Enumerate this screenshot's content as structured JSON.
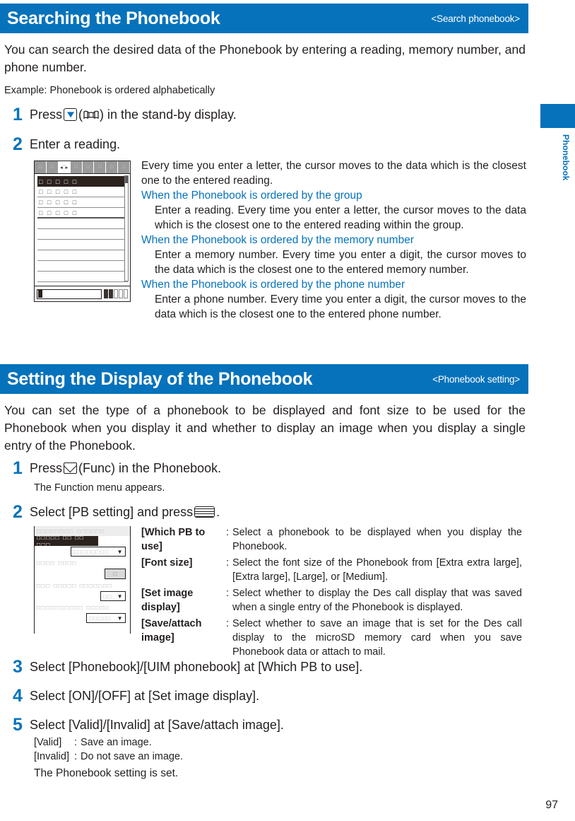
{
  "page": {
    "number": "97",
    "thumb_tab_label": "Phonebook",
    "accent_color": "#0672bb",
    "text_color": "#231f20"
  },
  "section1": {
    "title": "Searching the Phonebook",
    "tag": "<Search phonebook>",
    "intro": "You can search the desired data of the Phonebook by entering a reading, memory number, and phone number.",
    "example": "Example: Phonebook is ordered alphabetically",
    "steps": [
      {
        "num": "1",
        "before": "Press",
        "key": "down-key",
        "mid": "(",
        "key2": "phonebook-book-icon",
        "after": ") in the stand-by display."
      },
      {
        "num": "2",
        "text": "Enter a reading."
      }
    ],
    "descriptions": {
      "main": "Every time you enter a letter, the cursor moves to the data which is the closest one to the entered reading.",
      "blocks": [
        {
          "head": "When the Phonebook is ordered by the group",
          "body": "Enter a reading. Every time you enter a letter, the cursor moves to the data which is the closest one to the entered reading within the group."
        },
        {
          "head": "When the Phonebook is ordered by the memory number",
          "body": "Enter a memory number. Every time you enter a digit, the cursor moves to the data which is the closest one to the entered memory number."
        },
        {
          "head": "When the Phonebook is ordered by the phone number",
          "body": "Enter a phone number. Every time you enter a digit, the cursor moves to the data which is the closest one to the entered phone number."
        }
      ]
    }
  },
  "section2": {
    "title": "Setting the Display of the Phonebook",
    "tag": "<Phonebook setting>",
    "intro": "You can set the type of a phonebook to be displayed and font size to be used for the Phonebook when you display it and whether to display an image when you display a single entry of the Phonebook.",
    "steps": [
      {
        "num": "1",
        "before": "Press",
        "key": "mail-func-key",
        "after": "(Func) in the Phonebook.",
        "sub": "The Function menu appears."
      },
      {
        "num": "2",
        "before": "Select [PB setting] and press",
        "key": "select-key",
        "after": "."
      },
      {
        "num": "3",
        "text": "Select [Phonebook]/[UIM phonebook] at [Which PB to use]."
      },
      {
        "num": "4",
        "text": "Select [ON]/[OFF] at [Set image display]."
      },
      {
        "num": "5",
        "text": "Select [Valid]/[Invalid] at [Save/attach image]."
      }
    ],
    "settings": [
      {
        "term": "[Which PB to use]",
        "colon": ":",
        "desc": "Select a phonebook to be displayed when you display the Phonebook."
      },
      {
        "term": "[Font size]",
        "colon": ":",
        "desc": "Select the font size of the Phonebook from [Extra extra large], [Extra large], [Large], or [Medium]."
      },
      {
        "term": "[Set image display]",
        "colon": ":",
        "desc": "Select whether to display the Des call display that was saved when a single entry of the Phonebook is displayed."
      },
      {
        "term": "[Save/attach image]",
        "colon": ":",
        "desc": "Select whether to save an image that is set for the Des call display to the microSD memory card when you save Phonebook data or attach to mail."
      }
    ],
    "step5_values": [
      {
        "term": "[Valid]",
        "colon": ":",
        "desc": "Save an image."
      },
      {
        "term": "[Invalid]",
        "colon": ":",
        "desc": "Do not save an image."
      }
    ],
    "closing": "The Phonebook setting is set."
  },
  "mockup_search": {
    "tab_count": "9",
    "active_tab_index": "2",
    "rows": [
      "□ □ □ □ □",
      "□ □ □ □ □",
      "□ □ □ □ □",
      "□ □ □ □ □"
    ],
    "selected_row_index": "0"
  },
  "mockup_settings": {
    "title": "□□□□□□□□ □□□□□□",
    "highlight": "□□□□□ □□ □□ □□□",
    "field1_value": "□□□□□□□□",
    "label2": "□□□□ □□□□",
    "field2_value": "□",
    "label3": "□□□ □□□□□ □□□□□□□",
    "field3_value": "□□",
    "label4": "□□□□□□□□□□ □□□□□",
    "field4_value": "□□□□□"
  }
}
